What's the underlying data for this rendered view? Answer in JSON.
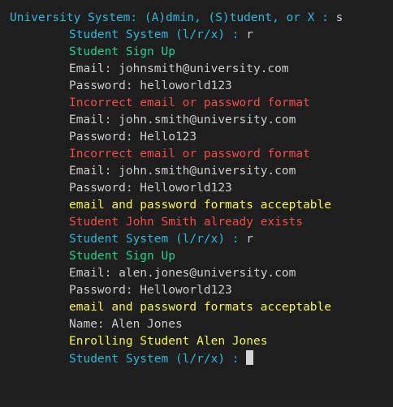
{
  "colors": {
    "background": "#1e1e1e",
    "cyan": "#29b8db",
    "green": "#23d18b",
    "red": "#f14c4c",
    "yellow": "#f5f543",
    "white": "#cccccc"
  },
  "lines": [
    {
      "prompt": "University System: (A)dmin, (S)tudent, or X : ",
      "input": "s",
      "color": "cyan",
      "indent": 0
    },
    {
      "prompt": "Student System (l/r/x) : ",
      "input": "r",
      "color": "cyan",
      "indent": 1
    },
    {
      "text": "Student Sign Up",
      "color": "green",
      "indent": 1
    },
    {
      "text": "Email: johnsmith@university.com",
      "color": "white",
      "indent": 1
    },
    {
      "text": "Password: helloworld123",
      "color": "white",
      "indent": 1
    },
    {
      "text": "Incorrect email or password format",
      "color": "red",
      "indent": 1
    },
    {
      "text": "Email: john.smith@university.com",
      "color": "white",
      "indent": 1
    },
    {
      "text": "Password: Hello123",
      "color": "white",
      "indent": 1
    },
    {
      "text": "Incorrect email or password format",
      "color": "red",
      "indent": 1
    },
    {
      "text": "Email: john.smith@university.com",
      "color": "white",
      "indent": 1
    },
    {
      "text": "Password: Helloworld123",
      "color": "white",
      "indent": 1
    },
    {
      "text": "email and password formats acceptable",
      "color": "yellow",
      "indent": 1
    },
    {
      "text": "Student John Smith already exists",
      "color": "red",
      "indent": 1
    },
    {
      "prompt": "Student System (l/r/x) : ",
      "input": "r",
      "color": "cyan",
      "indent": 1
    },
    {
      "text": "Student Sign Up",
      "color": "green",
      "indent": 1
    },
    {
      "text": "Email: alen.jones@university.com",
      "color": "white",
      "indent": 1
    },
    {
      "text": "Password: Helloworld123",
      "color": "white",
      "indent": 1
    },
    {
      "text": "email and password formats acceptable",
      "color": "yellow",
      "indent": 1
    },
    {
      "text": "Name: Alen Jones",
      "color": "white",
      "indent": 1
    },
    {
      "text": "Enrolling Student Alen Jones",
      "color": "yellow",
      "indent": 1
    },
    {
      "prompt": "Student System (l/r/x) : ",
      "input": "",
      "color": "cyan",
      "indent": 1,
      "cursor": true
    }
  ]
}
